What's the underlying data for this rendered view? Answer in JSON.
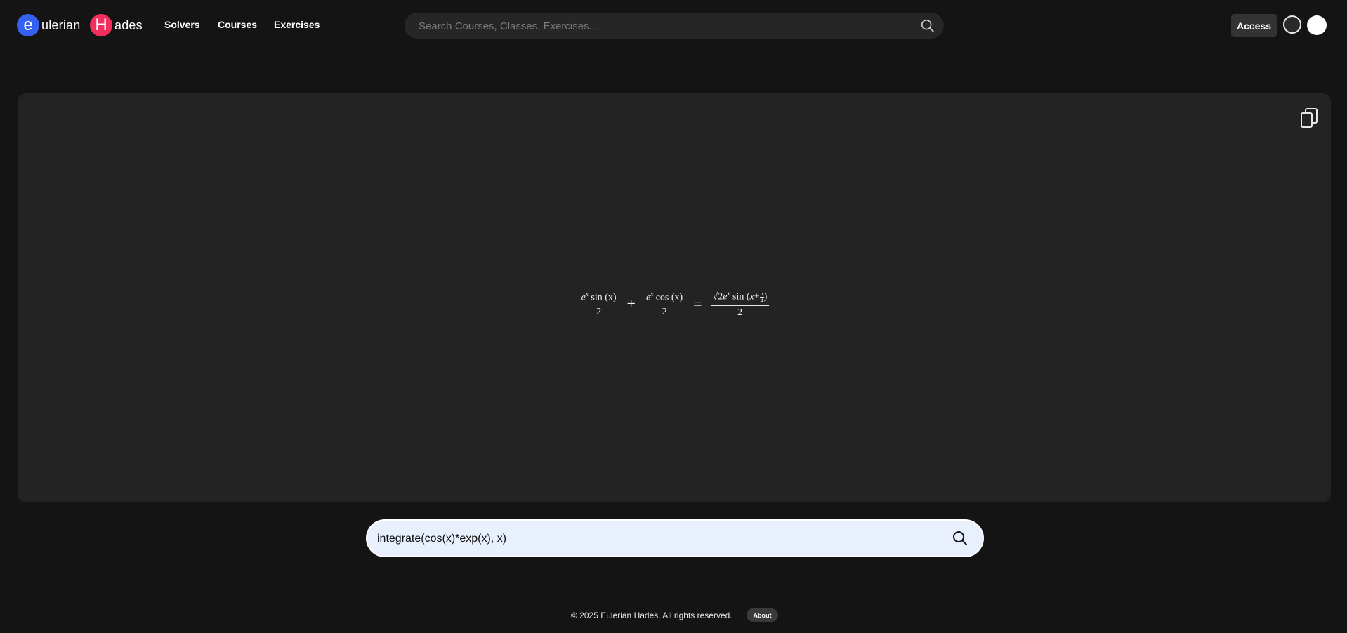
{
  "header": {
    "logo_e_letter": "e",
    "logo_e_word": "ulerian",
    "logo_h_letter": "H",
    "logo_h_word": "ades",
    "nav": [
      "Solvers",
      "Courses",
      "Exercises"
    ],
    "search_placeholder": "Search Courses, Classes, Exercises...",
    "access_label": "Access"
  },
  "colors": {
    "background": "#141414",
    "panel": "#232323",
    "logo_e": "#3461f0",
    "logo_h": "#f22e5c",
    "input_bg": "#e8effd"
  },
  "result": {
    "term1_num_base": "e",
    "term1_num_exp": "x",
    "term1_num_rest": "sin (x)",
    "term1_den": "2",
    "plus": "+",
    "term2_num_base": "e",
    "term2_num_exp": "x",
    "term2_num_rest": "cos (x)",
    "term2_den": "2",
    "equals": "=",
    "rhs_sqrt": "√2",
    "rhs_base": "e",
    "rhs_exp": "x",
    "rhs_func": "sin",
    "rhs_arg_var": "x",
    "rhs_arg_plus": "+",
    "rhs_arg_frac_num": "π",
    "rhs_arg_frac_den": "4",
    "rhs_den": "2",
    "copy_icon": "copy-icon"
  },
  "input": {
    "value": "integrate(cos(x)*exp(x), x)"
  },
  "footer": {
    "copyright": "© 2025 Eulerian Hades. All rights reserved.",
    "about_label": "About"
  }
}
